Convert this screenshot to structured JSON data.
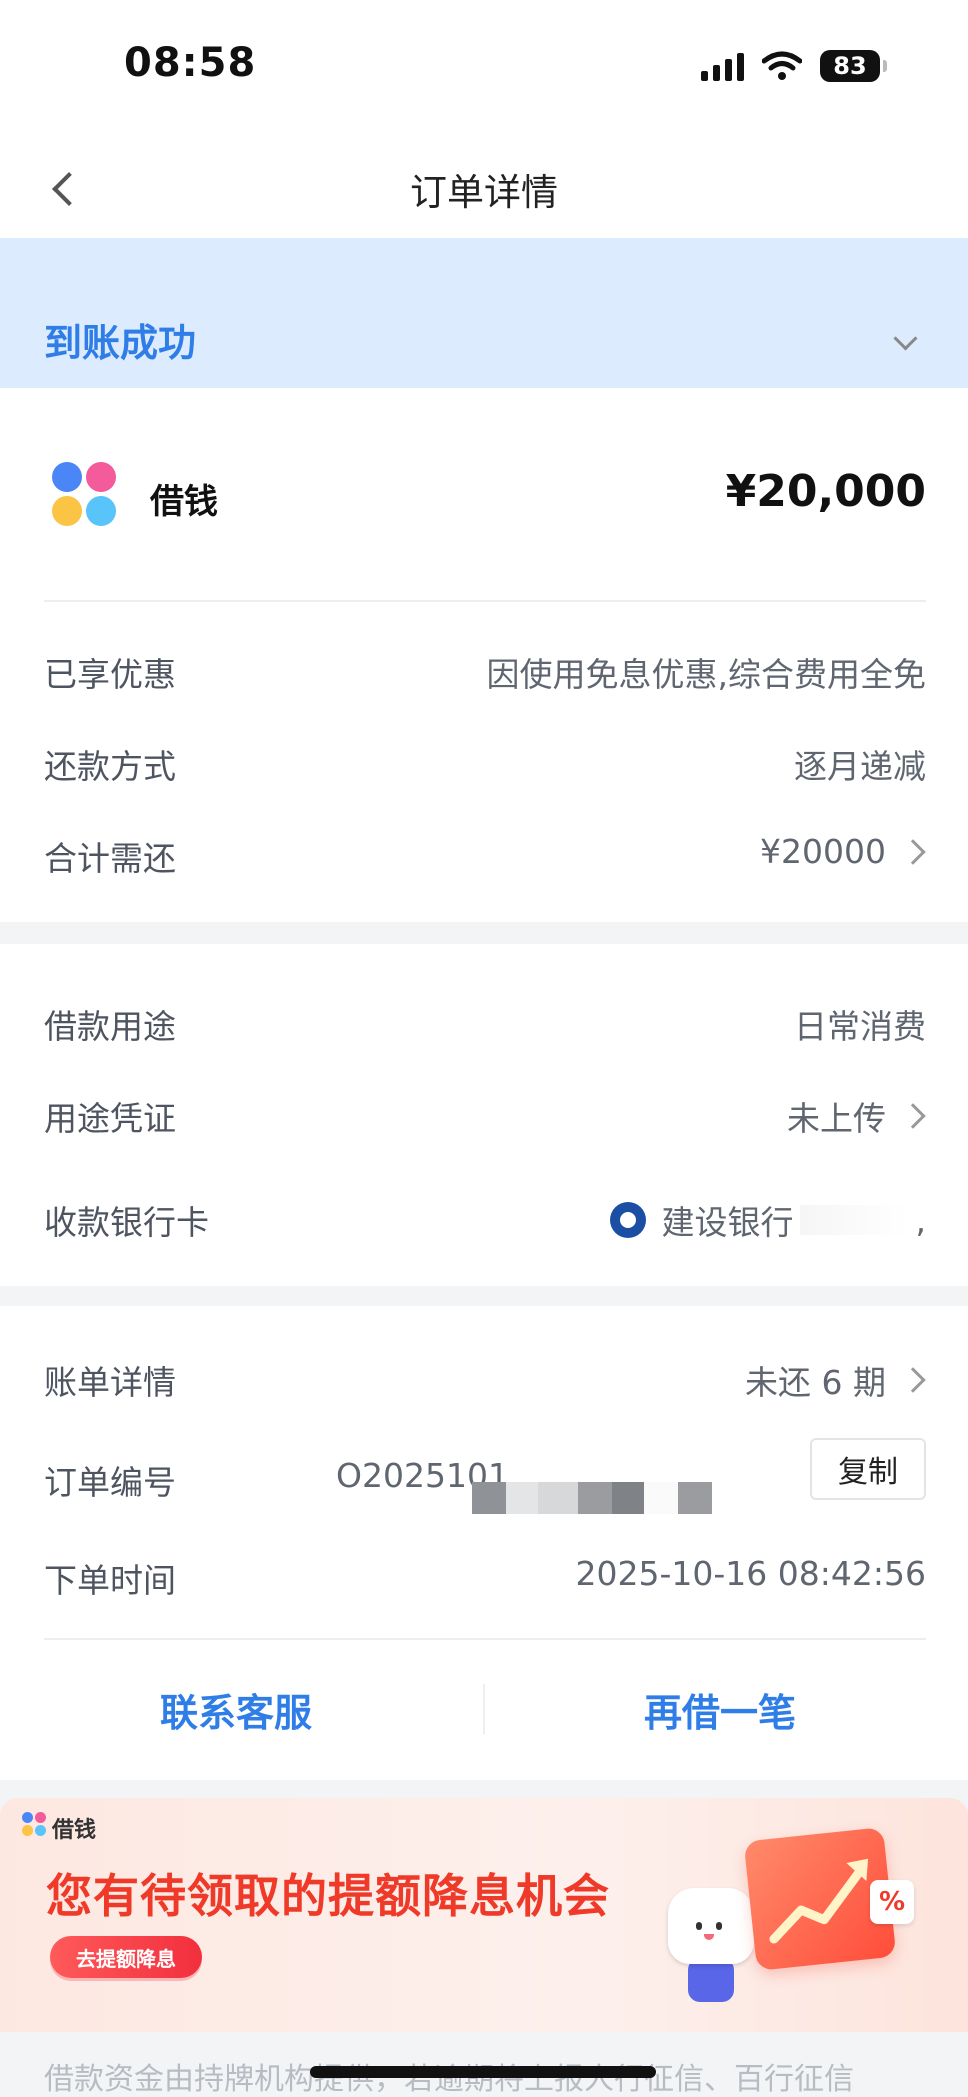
{
  "status_bar": {
    "time": "08:58",
    "battery": "83"
  },
  "nav": {
    "title": "订单详情"
  },
  "status": {
    "text": "到账成功"
  },
  "loan": {
    "product_name": "借钱",
    "amount": "¥20,000"
  },
  "fee_rows": [
    {
      "label": "已享优惠",
      "value": "因使用免息优惠,综合费用全免"
    },
    {
      "label": "还款方式",
      "value": "逐月递减"
    },
    {
      "label": "合计需还",
      "value": "¥20000"
    }
  ],
  "usage_rows": [
    {
      "label": "借款用途",
      "value": "日常消费"
    },
    {
      "label": "用途凭证",
      "value": "未上传"
    },
    {
      "label": "收款银行卡",
      "bank_name": "建设银行",
      "suffix": ","
    }
  ],
  "bill": {
    "detail_label": "账单详情",
    "detail_value": "未还 6 期",
    "order_label": "订单编号",
    "order_no": "O2025101",
    "copy_label": "复制",
    "time_label": "下单时间",
    "time_value": "2025-10-16 08:42:56"
  },
  "actions": {
    "contact": "联系客服",
    "reborrow": "再借一笔"
  },
  "promo": {
    "brand": "借钱",
    "title": "您有待领取的提额降息机会",
    "button": "去提额降息",
    "badge": "%"
  },
  "footer": {
    "note": "借款资金由持牌机构提供，若逾期将上报人行征信、百行征信"
  },
  "colors": {
    "accent": "#2f7ee8",
    "banner_bg": "#dcebfd",
    "promo_red": "#ef3a2a"
  }
}
